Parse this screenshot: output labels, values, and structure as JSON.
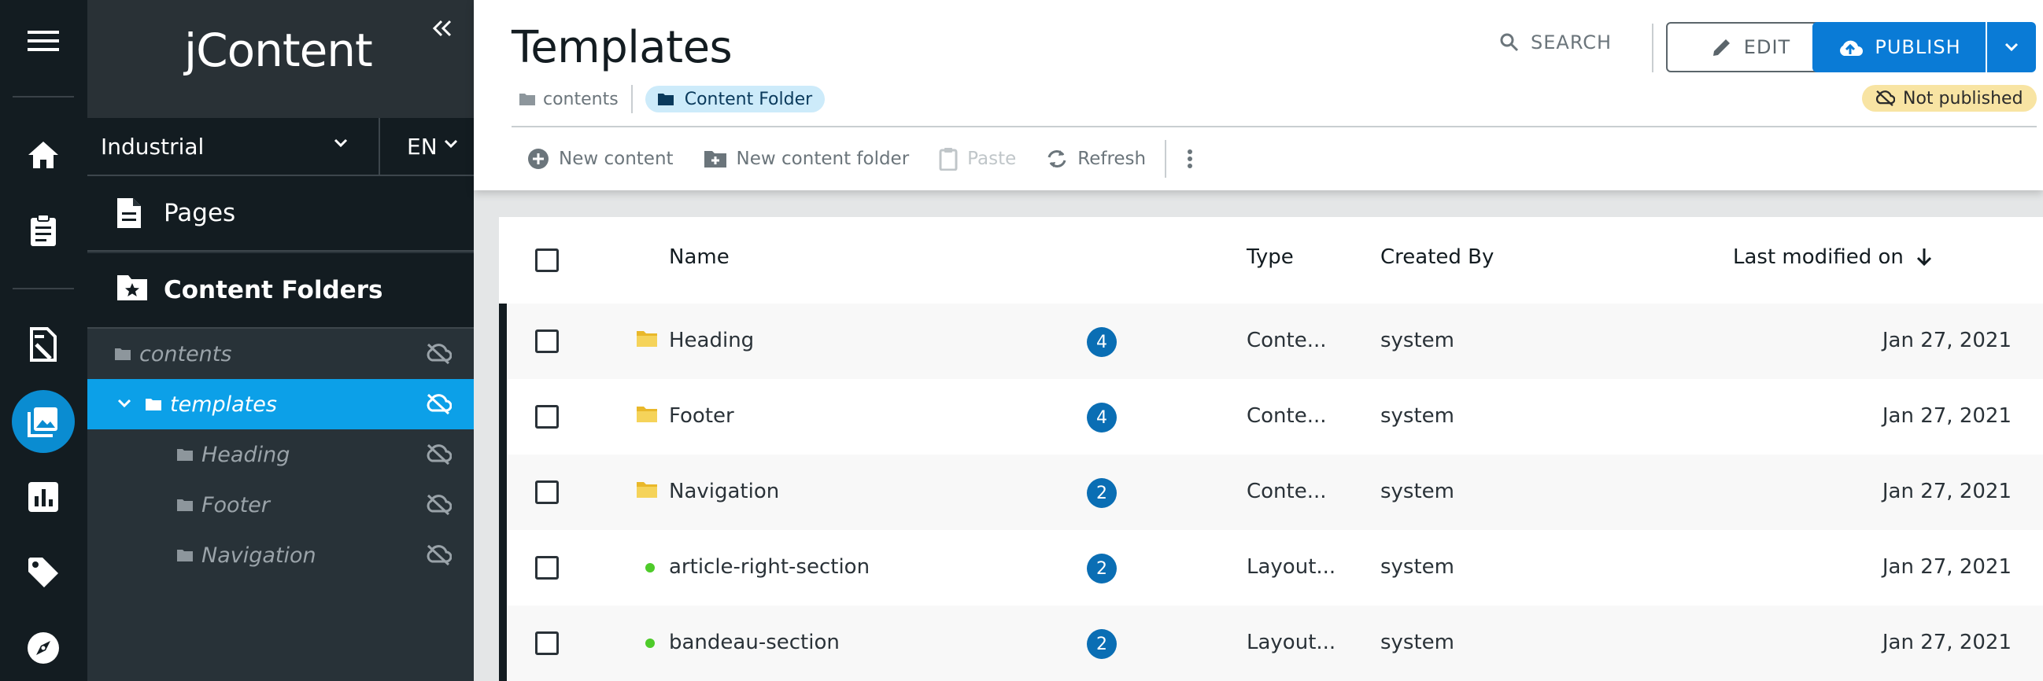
{
  "app": {
    "logo_text": "jContent"
  },
  "rail": {
    "items": [
      {
        "icon": "menu-icon"
      },
      {
        "icon": "home-icon"
      },
      {
        "icon": "clipboard-icon"
      },
      {
        "icon": "content-editor-icon"
      },
      {
        "icon": "media-icon",
        "active": true
      },
      {
        "icon": "analytics-icon"
      },
      {
        "icon": "tag-icon"
      },
      {
        "icon": "compass-icon"
      }
    ],
    "active_color": "#0a8cd1"
  },
  "secnav": {
    "site": "Industrial",
    "language": "EN",
    "accordions": [
      {
        "label": "Pages",
        "icon": "page-icon"
      },
      {
        "label": "Content Folders",
        "icon": "folder-star-icon"
      }
    ],
    "tree": [
      {
        "label": "contents",
        "level": 0,
        "selected": false
      },
      {
        "label": "templates",
        "level": 1,
        "selected": true,
        "expanded": true
      },
      {
        "label": "Heading",
        "level": 2,
        "selected": false
      },
      {
        "label": "Footer",
        "level": 2,
        "selected": false
      },
      {
        "label": "Navigation",
        "level": 2,
        "selected": false
      }
    ]
  },
  "header": {
    "title": "Templates",
    "search_label": "SEARCH",
    "edit_label": "EDIT",
    "publish_label": "PUBLISH",
    "breadcrumb": {
      "root": "contents",
      "current": "Content Folder"
    },
    "status": "Not published"
  },
  "toolbar": {
    "new_content": "New content",
    "new_folder": "New content folder",
    "paste": "Paste",
    "refresh": "Refresh"
  },
  "table": {
    "columns": {
      "name": "Name",
      "type": "Type",
      "created_by": "Created By",
      "modified": "Last modified on"
    },
    "sort": {
      "column": "Last modified on",
      "direction": "descending"
    },
    "rows": [
      {
        "name": "Heading",
        "kind": "folder",
        "count": "4",
        "type": "Conte...",
        "created_by": "system",
        "modified": "Jan 27, 2021"
      },
      {
        "name": "Footer",
        "kind": "folder",
        "count": "4",
        "type": "Conte...",
        "created_by": "system",
        "modified": "Jan 27, 2021"
      },
      {
        "name": "Navigation",
        "kind": "folder",
        "count": "2",
        "type": "Conte...",
        "created_by": "system",
        "modified": "Jan 27, 2021"
      },
      {
        "name": "article-right-section",
        "kind": "published-dot",
        "count": "2",
        "type": "Layout...",
        "created_by": "system",
        "modified": "Jan 27, 2021"
      },
      {
        "name": "bandeau-section",
        "kind": "published-dot",
        "count": "2",
        "type": "Layout...",
        "created_by": "system",
        "modified": "Jan 27, 2021"
      }
    ]
  },
  "colors": {
    "rail_bg": "#131c21",
    "secnav_bg": "#283238",
    "selected_tree": "#0ca0e8",
    "primary": "#0a7bd6",
    "badge": "#0a6eb4",
    "status_unpublished": "#f8e4a3",
    "published_dot": "#4ecb2a"
  }
}
